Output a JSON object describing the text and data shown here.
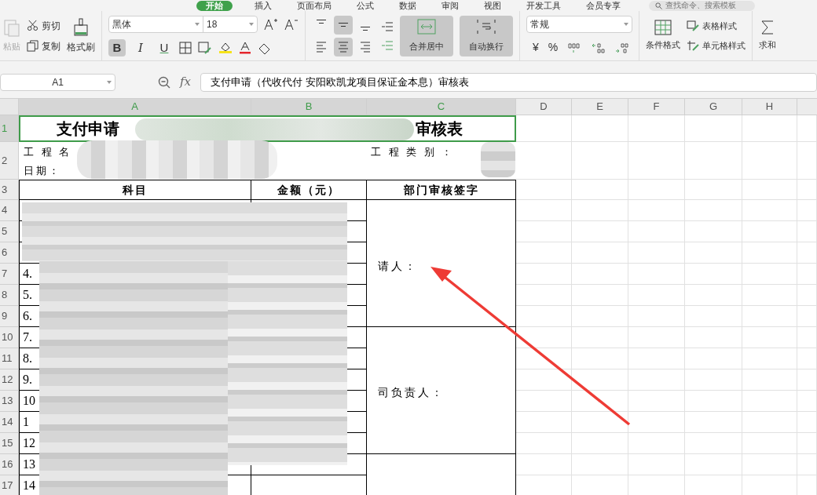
{
  "menu_tabs": [
    {
      "label": "开始",
      "selected": true
    },
    {
      "label": "插入",
      "selected": false
    },
    {
      "label": "页面布局",
      "selected": false
    },
    {
      "label": "公式",
      "selected": false
    },
    {
      "label": "数据",
      "selected": false
    },
    {
      "label": "审阅",
      "selected": false
    },
    {
      "label": "视图",
      "selected": false
    },
    {
      "label": "开发工具",
      "selected": false
    },
    {
      "label": "会员专享",
      "selected": false
    }
  ],
  "search": {
    "placeholder": "查找命令、搜索模板"
  },
  "clipboard": {
    "paste": {
      "label": "粘贴",
      "disabled": true
    },
    "cut": "剪切",
    "copy": "复制",
    "format_painter": "格式刷"
  },
  "font": {
    "name": "黑体",
    "size": "18",
    "styles": [
      {
        "kind": "bold",
        "label": "B",
        "selected": true
      },
      {
        "kind": "italic",
        "label": "I",
        "selected": false
      },
      {
        "kind": "underline",
        "label": "U",
        "selected": false
      }
    ]
  },
  "alignment": [
    {
      "kind": "top",
      "selected": false
    },
    {
      "kind": "middle",
      "selected": true
    },
    {
      "kind": "bottom",
      "selected": false
    },
    {
      "kind": "left",
      "selected": false
    },
    {
      "kind": "center",
      "selected": true
    },
    {
      "kind": "right",
      "selected": false
    }
  ],
  "merge_center": {
    "label": "合并居中",
    "selected": true
  },
  "wrap_text": {
    "label": "自动换行",
    "selected": true
  },
  "number_format": {
    "value": "常规",
    "currency": "¥",
    "percent": "%"
  },
  "styles": {
    "conditional": "条件格式",
    "table_style": "表格样式",
    "cell_style": "单元格样式",
    "sum": "求和"
  },
  "formula_bar": {
    "name_box": "A1",
    "fx": "fx",
    "formula": "支付申请（代收代付 安阳欧凯龙项目保证金本息）审核表"
  },
  "sheet": {
    "columns": [
      {
        "label": "A",
        "selected": true
      },
      {
        "label": "B",
        "selected": true
      },
      {
        "label": "C",
        "selected": true
      },
      {
        "label": "D",
        "selected": false
      },
      {
        "label": "E",
        "selected": false
      },
      {
        "label": "F",
        "selected": false
      },
      {
        "label": "G",
        "selected": false
      },
      {
        "label": "H",
        "selected": false
      }
    ],
    "rows": [
      {
        "label": "1",
        "selected": true
      },
      {
        "label": "2",
        "selected": false
      },
      {
        "label": "3",
        "selected": false
      },
      {
        "label": "4",
        "selected": false
      },
      {
        "label": "5",
        "selected": false
      },
      {
        "label": "6",
        "selected": false
      },
      {
        "label": "7",
        "selected": false
      },
      {
        "label": "8",
        "selected": false
      },
      {
        "label": "9",
        "selected": false
      },
      {
        "label": "10",
        "selected": false
      },
      {
        "label": "11",
        "selected": false
      },
      {
        "label": "12",
        "selected": false
      },
      {
        "label": "13",
        "selected": false
      },
      {
        "label": "14",
        "selected": false
      },
      {
        "label": "15",
        "selected": false
      },
      {
        "label": "16",
        "selected": false
      },
      {
        "label": "17",
        "selected": false
      }
    ],
    "title_left": "支付申请",
    "title_right": "审核表",
    "project_name_label": "工 程 名",
    "project_type_label": "工 程 类 别 ：",
    "date_label": "日期：",
    "headers": [
      "科目",
      "金额（元）",
      "部门审核签字"
    ],
    "item_numbers": [
      "4.",
      "5.",
      "6.",
      "7.",
      "8.",
      "9.",
      "10",
      "1",
      "12",
      "13",
      "14"
    ],
    "applicant_label": "请人：",
    "manager_label": "司负责人："
  }
}
